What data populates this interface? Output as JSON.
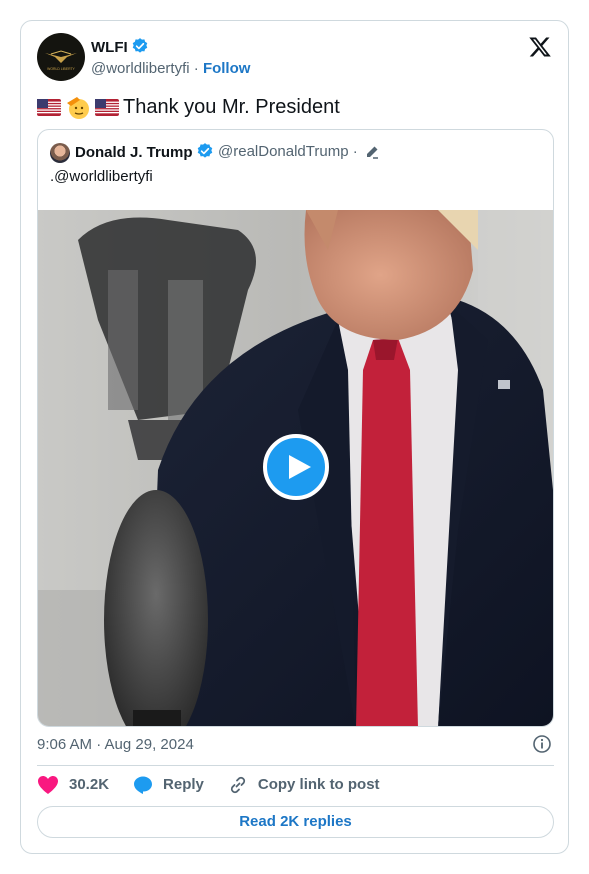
{
  "author": {
    "name": "WLFI",
    "handle": "@worldlibertyfi",
    "separator": "·",
    "follow_label": "Follow",
    "logo_text": "WORLD LIBERTY"
  },
  "tweet": {
    "emojis": [
      "us-flag",
      "saluting-face",
      "us-flag"
    ],
    "text": "Thank you Mr. President"
  },
  "quote": {
    "name": "Donald J. Trump",
    "handle": "@realDonaldTrump",
    "separator": "·",
    "text": ".@worldlibertyfi"
  },
  "meta": {
    "timestamp": "9:06 AM · Aug 29, 2024"
  },
  "actions": {
    "likes": "30.2K",
    "reply_label": "Reply",
    "copy_label": "Copy link to post"
  },
  "footer": {
    "read_replies": "Read 2K replies"
  },
  "colors": {
    "brand_blue": "#1d9bf0",
    "link_blue": "#1d77c6",
    "like_pink": "#f91880",
    "muted": "#536471",
    "border": "#cfd9de"
  }
}
